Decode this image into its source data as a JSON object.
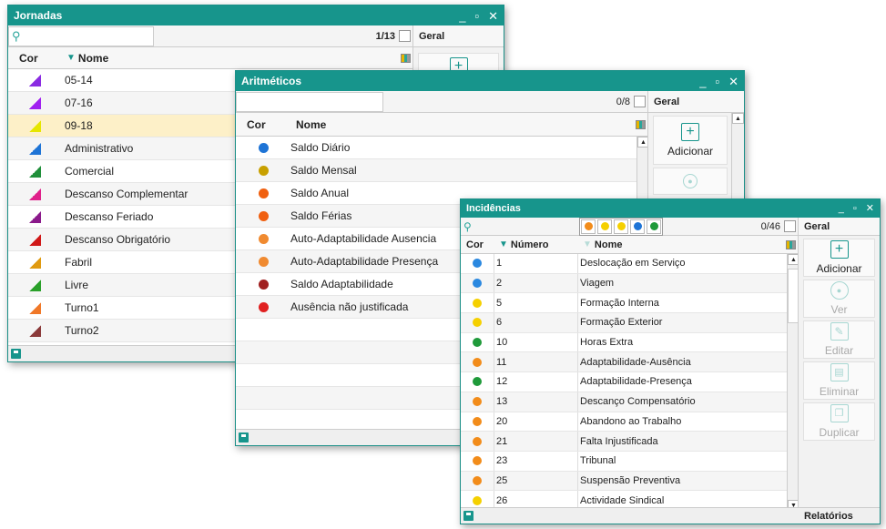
{
  "jornadas": {
    "title": "Jornadas",
    "counter": "1/13",
    "side_header": "Geral",
    "col_cor": "Cor",
    "col_nome": "Nome",
    "rows": [
      {
        "name": "05-14",
        "color": "#8a2be2"
      },
      {
        "name": "07-16",
        "color": "#a020f0"
      },
      {
        "name": "09-18",
        "color": "#e6e600"
      },
      {
        "name": "Administrativo",
        "color": "#1e74d6"
      },
      {
        "name": "Comercial",
        "color": "#1f8f3a"
      },
      {
        "name": "Descanso Complementar",
        "color": "#e0208a"
      },
      {
        "name": "Descanso Feriado",
        "color": "#8b1a8b"
      },
      {
        "name": "Descanso Obrigatório",
        "color": "#d01818"
      },
      {
        "name": "Fabril",
        "color": "#e09a10"
      },
      {
        "name": "Livre",
        "color": "#2aa02a"
      },
      {
        "name": "Turno1",
        "color": "#f07828"
      },
      {
        "name": "Turno2",
        "color": "#8b3a3a"
      }
    ]
  },
  "aritmeticos": {
    "title": "Aritméticos",
    "counter": "0/8",
    "side_header": "Geral",
    "col_cor": "Cor",
    "col_nome": "Nome",
    "add_label": "Adicionar",
    "rows": [
      {
        "name": "Saldo Diário",
        "color": "#1e74d6"
      },
      {
        "name": "Saldo Mensal",
        "color": "#c8a000"
      },
      {
        "name": "Saldo Anual",
        "color": "#f06010"
      },
      {
        "name": "Saldo Férias",
        "color": "#f06010"
      },
      {
        "name": "Auto-Adaptabilidade Ausencia",
        "color": "#f08a30"
      },
      {
        "name": "Auto-Adaptabilidade Presença",
        "color": "#f08a30"
      },
      {
        "name": "Saldo Adaptabilidade",
        "color": "#a02020"
      },
      {
        "name": "Ausência não justificada",
        "color": "#e02020"
      }
    ]
  },
  "incidencias": {
    "title": "Incidências",
    "counter": "0/46",
    "side_header": "Geral",
    "col_cor": "Cor",
    "col_numero": "Número",
    "col_nome": "Nome",
    "filter_colors": [
      "#f28c1a",
      "#f5d000",
      "#f5d000",
      "#1e74d6",
      "#1f9a3a"
    ],
    "actions": {
      "add": "Adicionar",
      "view": "Ver",
      "edit": "Editar",
      "delete": "Eliminar",
      "duplicate": "Duplicar"
    },
    "footer_label": "Relatórios",
    "rows": [
      {
        "num": "1",
        "name": "Deslocação em Serviço",
        "color": "#2a88e0"
      },
      {
        "num": "2",
        "name": "Viagem",
        "color": "#2a88e0"
      },
      {
        "num": "5",
        "name": "Formação Interna",
        "color": "#f5d000"
      },
      {
        "num": "6",
        "name": "Formação Exterior",
        "color": "#f5d000"
      },
      {
        "num": "10",
        "name": "Horas Extra",
        "color": "#1f9a3a"
      },
      {
        "num": "11",
        "name": "Adaptabilidade-Ausência",
        "color": "#f28c1a"
      },
      {
        "num": "12",
        "name": "Adaptabilidade-Presença",
        "color": "#1f9a3a"
      },
      {
        "num": "13",
        "name": "Descanço Compensatório",
        "color": "#f28c1a"
      },
      {
        "num": "20",
        "name": "Abandono ao Trabalho",
        "color": "#f28c1a"
      },
      {
        "num": "21",
        "name": "Falta Injustificada",
        "color": "#f28c1a"
      },
      {
        "num": "23",
        "name": "Tribunal",
        "color": "#f28c1a"
      },
      {
        "num": "25",
        "name": "Suspensão Preventiva",
        "color": "#f28c1a"
      },
      {
        "num": "26",
        "name": "Actividade Sindical",
        "color": "#f5d000"
      }
    ]
  },
  "window_controls": {
    "minimize": "_",
    "maximize": "▫",
    "close": "✕"
  }
}
